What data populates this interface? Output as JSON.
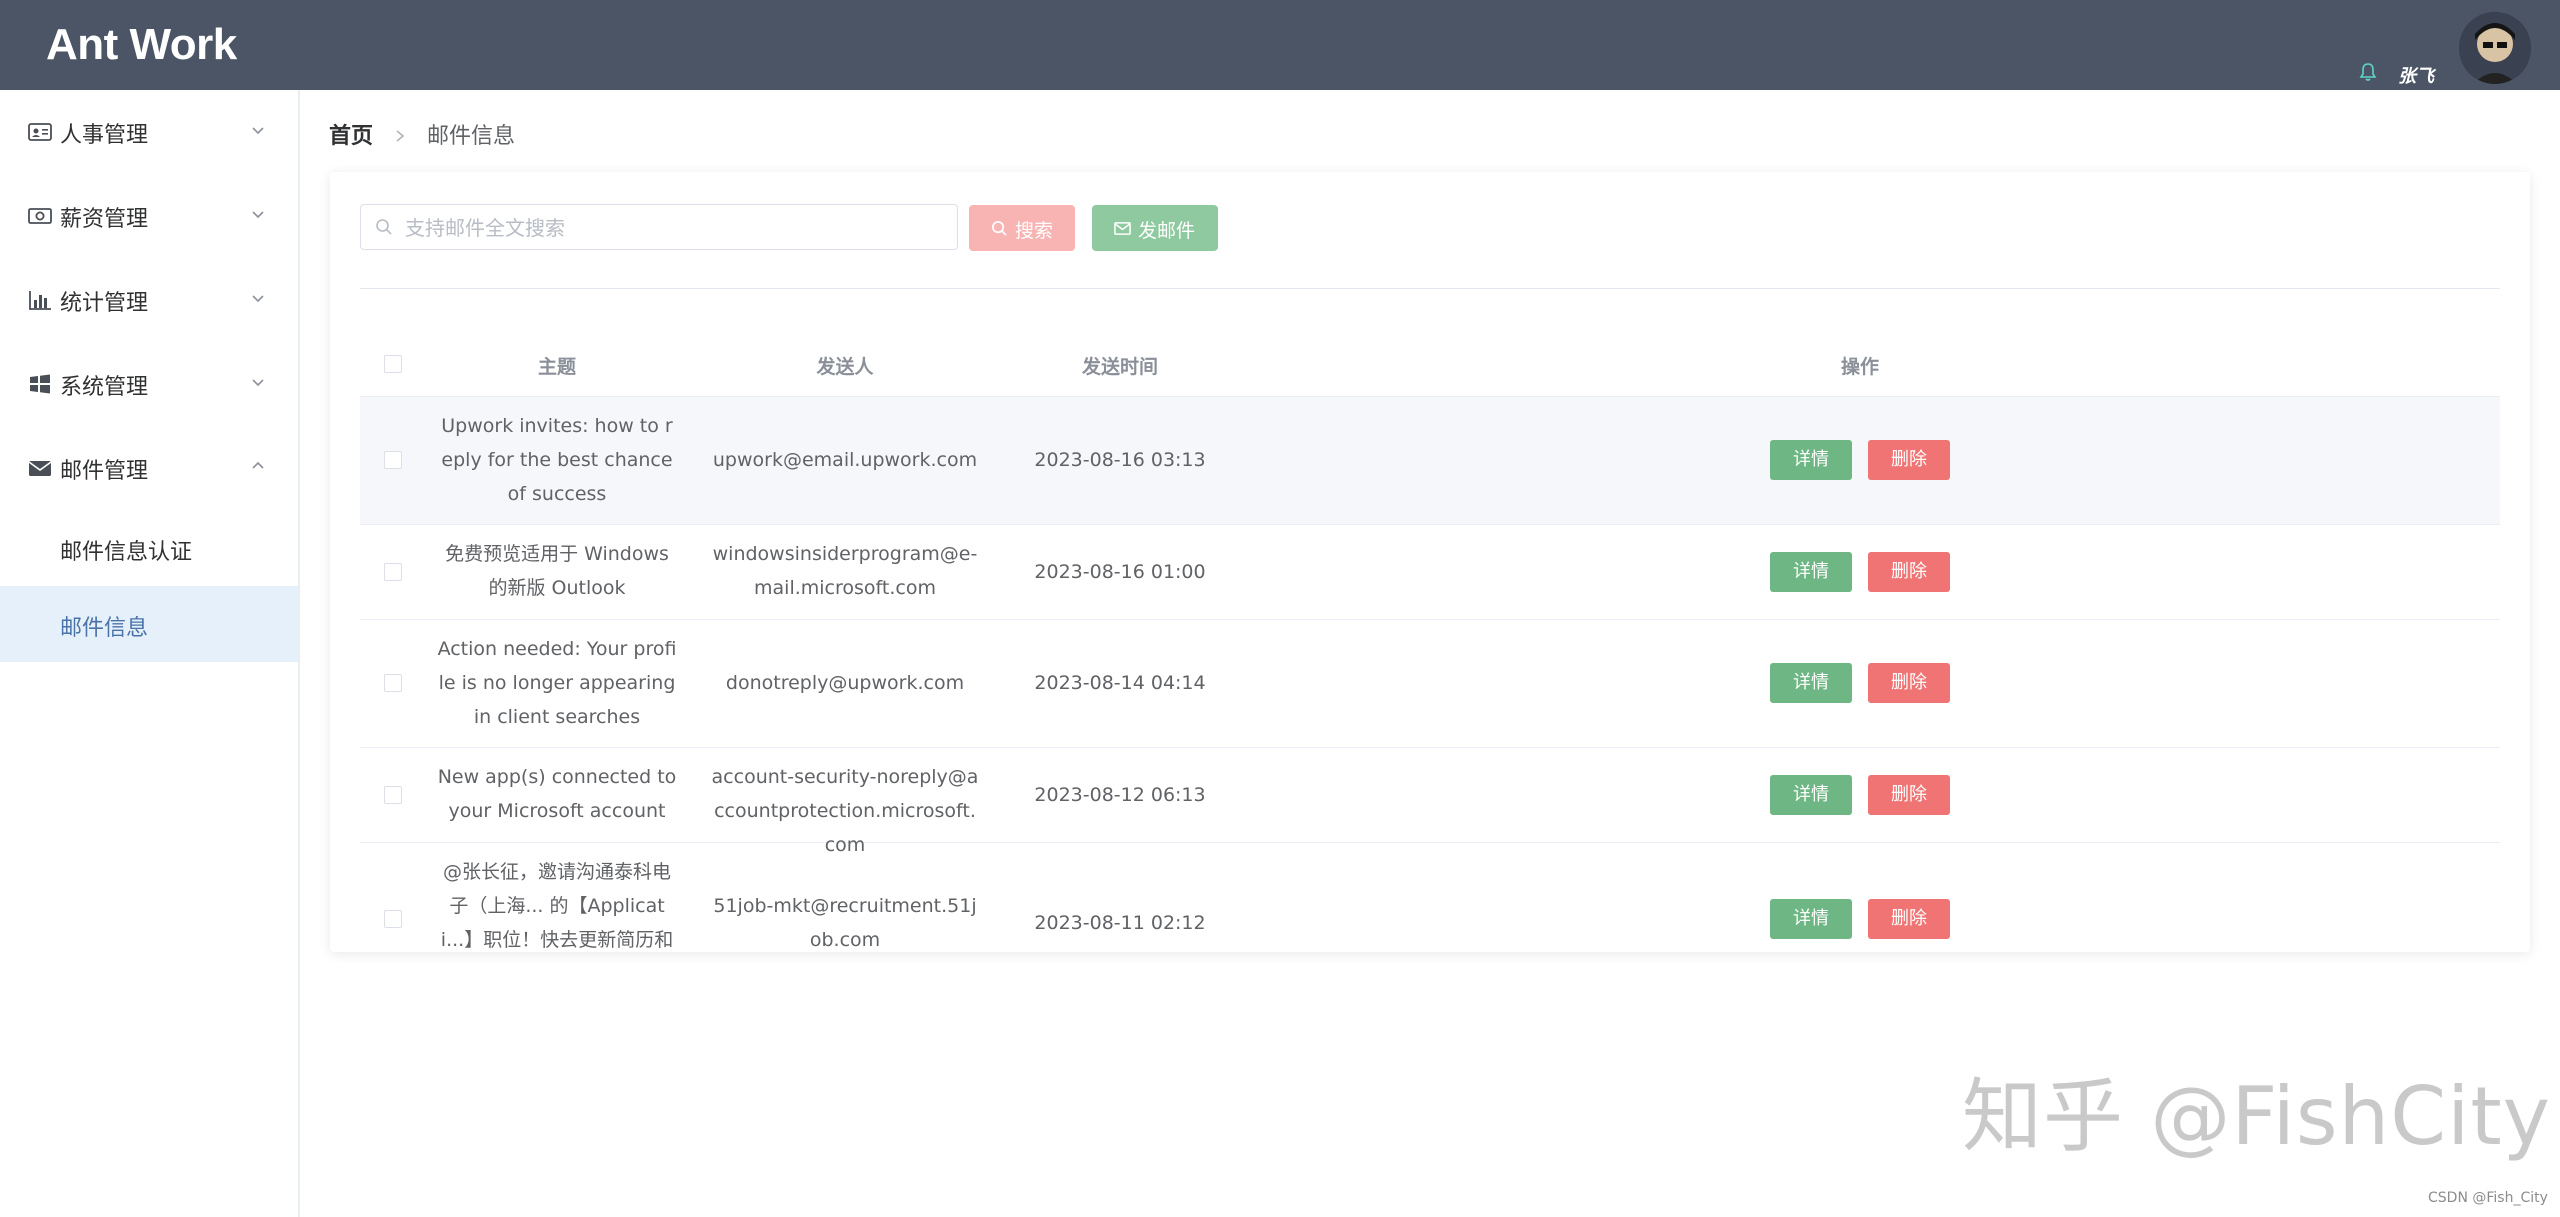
{
  "header": {
    "logo": "Ant Work",
    "username": "张飞"
  },
  "sidebar": {
    "items": [
      {
        "label": "人事管理",
        "icon": "id-card-icon",
        "expanded": false
      },
      {
        "label": "薪资管理",
        "icon": "money-icon",
        "expanded": false
      },
      {
        "label": "统计管理",
        "icon": "bar-chart-icon",
        "expanded": false
      },
      {
        "label": "系统管理",
        "icon": "windows-icon",
        "expanded": false
      },
      {
        "label": "邮件管理",
        "icon": "envelope-icon",
        "expanded": true
      }
    ],
    "sub_items": [
      {
        "label": "邮件信息认证",
        "active": false
      },
      {
        "label": "邮件信息",
        "active": true
      }
    ]
  },
  "breadcrumb": {
    "home": "首页",
    "current": "邮件信息"
  },
  "toolbar": {
    "search_placeholder": "支持邮件全文搜索",
    "search_value": "",
    "search_button": "搜索",
    "send_button": "发邮件"
  },
  "table": {
    "columns": [
      "主题",
      "发送人",
      "发送时间",
      "操作"
    ],
    "detail_label": "详情",
    "delete_label": "删除",
    "rows": [
      {
        "subject": "Upwork invites: how to reply for the best chance of success",
        "sender": "upwork@email.upwork.com",
        "time": "2023-08-16 03:13"
      },
      {
        "subject": "免费预览适用于 Windows 的新版 Outlook",
        "sender": "windowsinsiderprogram@e-mail.microsoft.com",
        "time": "2023-08-16 01:00"
      },
      {
        "subject": "Action needed: Your profile is no longer appearing in client searches",
        "sender": "donotreply@upwork.com",
        "time": "2023-08-14 04:14"
      },
      {
        "subject": "New app(s) connected to your Microsoft account",
        "sender": "account-security-noreply@accountprotection.microsoft.com",
        "time": "2023-08-12 06:13"
      },
      {
        "subject": "@张长征，邀请沟通泰科电子（上海... 的【Applicati...】职位！快去更新简历和招聘经理j",
        "sender": "51job-mkt@recruitment.51job.com",
        "time": "2023-08-11 02:12"
      }
    ]
  },
  "watermark": "知乎 @FishCity",
  "csdn_mark": "CSDN @Fish_City",
  "colors": {
    "header_bg": "#4b5565",
    "active_menu_bg": "#e6f0fb",
    "search_button": "#f8b3b3",
    "send_button": "#8fc99f",
    "detail_button": "#6eb784",
    "delete_button": "#f07474"
  }
}
